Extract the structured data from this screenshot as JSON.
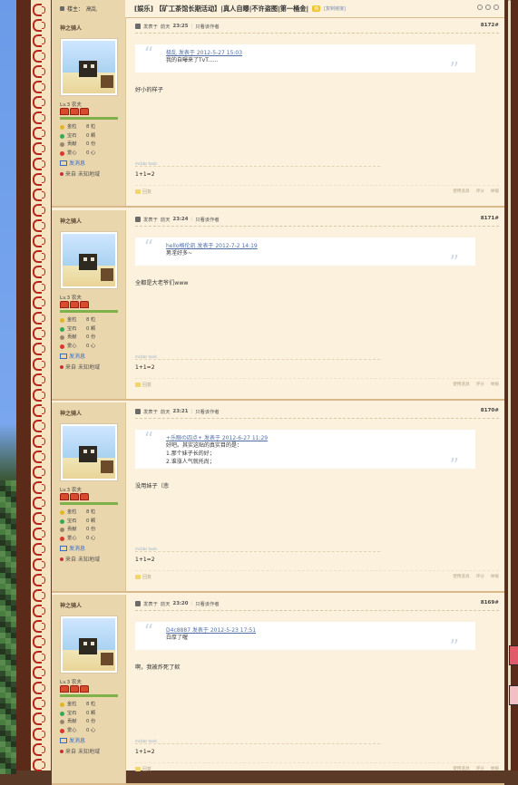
{
  "thread": {
    "title": "[娱乐] 【矿工茶馆长期活动】|真人自曝|不许盗图|第一桶金|",
    "badge": "热",
    "copy_link": "[复制链接]",
    "op_label": "楼主：",
    "op_name": "高乱"
  },
  "posts": [
    {
      "author": "神之骑人",
      "level": "Lv.3 农夫",
      "stats": [
        {
          "k": "金粒",
          "v": "8 粒",
          "color": "#e2b529"
        },
        {
          "k": "宝石",
          "v": "0 颗",
          "color": "#3aa85b"
        },
        {
          "k": "贡献",
          "v": "0 份",
          "color": "#9b8572"
        },
        {
          "k": "爱心",
          "v": "0 心",
          "color": "#d63a2e"
        }
      ],
      "message": "发消息",
      "from_label": "来自",
      "from_value": "未知地域",
      "posted_prefix": "发表于",
      "posted_day": "前天",
      "posted_time": "23:25",
      "only_author": "只看该作者",
      "floor": "8172#",
      "quote_link": "极乱 发表于 2012-5-27 15:03",
      "quote_lines": [
        "我的自曝来了TvT......"
      ],
      "reply": "好小的样子",
      "sig_mark": "mcbbs tools",
      "sig": "1+1=2",
      "reply_btn": "回复",
      "actions": [
        "使用道具",
        "评分",
        "举报"
      ]
    },
    {
      "author": "神之骑人",
      "level": "Lv.3 农夫",
      "stats": [
        {
          "k": "金粒",
          "v": "8 粒",
          "color": "#e2b529"
        },
        {
          "k": "宝石",
          "v": "0 颗",
          "color": "#3aa85b"
        },
        {
          "k": "贡献",
          "v": "0 份",
          "color": "#9b8572"
        },
        {
          "k": "爱心",
          "v": "0 心",
          "color": "#d63a2e"
        }
      ],
      "message": "发消息",
      "from_label": "来自",
      "from_value": "未知地域",
      "posted_prefix": "发表于",
      "posted_day": "前天",
      "posted_time": "23:24",
      "only_author": "只看该作者",
      "floor": "8171#",
      "quote_link": "hello格伦凯 发表于 2012-7-2 14:19",
      "quote_lines": [
        "男淫好多~"
      ],
      "reply": "全都是大老爷们www",
      "sig_mark": "mcbbs tools",
      "sig": "1+1=2",
      "reply_btn": "回复",
      "actions": [
        "使用道具",
        "评分",
        "举报"
      ]
    },
    {
      "author": "神之骑人",
      "level": "Lv.3 农夫",
      "stats": [
        {
          "k": "金粒",
          "v": "8 粒",
          "color": "#e2b529"
        },
        {
          "k": "宝石",
          "v": "0 颗",
          "color": "#3aa85b"
        },
        {
          "k": "贡献",
          "v": "0 份",
          "color": "#9b8572"
        },
        {
          "k": "爱心",
          "v": "0 心",
          "color": "#d63a2e"
        }
      ],
      "message": "发消息",
      "from_label": "来自",
      "from_value": "未知地域",
      "posted_prefix": "发表于",
      "posted_day": "前天",
      "posted_time": "23:21",
      "only_author": "只看该作者",
      "floor": "8170#",
      "quote_link": "+乐眼の四点+ 发表于 2012-6-27 11:29",
      "quote_lines": [
        "好吧。其实这贴的真实目的是：",
        "1.那个妹子长的好；",
        "2.谁涨人气就托尚；"
      ],
      "reply": "没用妹子（悲",
      "sig_mark": "mcbbs tools",
      "sig": "1+1=2",
      "reply_btn": "回复",
      "actions": [
        "使用道具",
        "评分",
        "举报"
      ]
    },
    {
      "author": "神之骑人",
      "level": "Lv.3 农夫",
      "stats": [
        {
          "k": "金粒",
          "v": "8 粒",
          "color": "#e2b529"
        },
        {
          "k": "宝石",
          "v": "0 颗",
          "color": "#3aa85b"
        },
        {
          "k": "贡献",
          "v": "0 份",
          "color": "#9b8572"
        },
        {
          "k": "爱心",
          "v": "0 心",
          "color": "#d63a2e"
        }
      ],
      "message": "发消息",
      "from_label": "来自",
      "from_value": "未知地域",
      "posted_prefix": "发表于",
      "posted_day": "前天",
      "posted_time": "23:20",
      "only_author": "只看该作者",
      "floor": "8169#",
      "quote_link": "D4c8887 发表于 2012-5-23 17:51",
      "quote_lines": [
        "白厚了喔"
      ],
      "reply": "啊，我被炸死了欸",
      "sig_mark": "mcbbs tools",
      "sig": "1+1=2",
      "reply_btn": "回复",
      "actions": [
        "使用道具",
        "评分",
        "举报"
      ]
    }
  ]
}
